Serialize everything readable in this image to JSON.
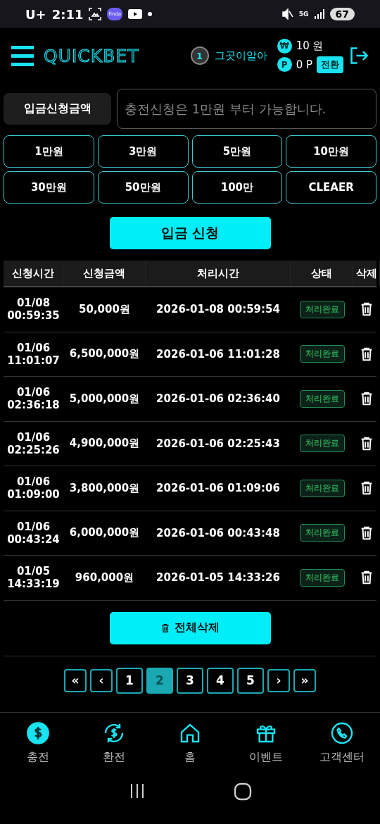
{
  "status_bar": {
    "carrier": "U+",
    "time": "2:11",
    "app_badge": "finda",
    "network": "5G",
    "battery": "67"
  },
  "header": {
    "logo": "QUICKBET",
    "level": "1",
    "username": "그곳이알아",
    "money_symbol": "₩",
    "money": "10 원",
    "point_symbol": "P",
    "points": "0 P",
    "convert_button": "전환"
  },
  "amount": {
    "label": "입금신청금액",
    "placeholder": "충전신청은 1만원 부터 가능합니다."
  },
  "quick_amounts": [
    "1만원",
    "3만원",
    "5만원",
    "10만원",
    "30만원",
    "50만원",
    "100만",
    "CLEAER"
  ],
  "submit_button": "입금 신청",
  "table": {
    "columns": [
      "신청시간",
      "신청금액",
      "처리시간",
      "상태",
      "삭제"
    ],
    "rows": [
      {
        "date": "01/08",
        "time": "00:59:35",
        "amount": "50,000원",
        "processed": "2026-01-08 00:59:54",
        "status": "처리완료"
      },
      {
        "date": "01/06",
        "time": "11:01:07",
        "amount": "6,500,000원",
        "processed": "2026-01-06 11:01:28",
        "status": "처리완료"
      },
      {
        "date": "01/06",
        "time": "02:36:18",
        "amount": "5,000,000원",
        "processed": "2026-01-06 02:36:40",
        "status": "처리완료"
      },
      {
        "date": "01/06",
        "time": "02:25:26",
        "amount": "4,900,000원",
        "processed": "2026-01-06 02:25:43",
        "status": "처리완료"
      },
      {
        "date": "01/06",
        "time": "01:09:00",
        "amount": "3,800,000원",
        "processed": "2026-01-06 01:09:06",
        "status": "처리완료"
      },
      {
        "date": "01/06",
        "time": "00:43:24",
        "amount": "6,000,000원",
        "processed": "2026-01-06 00:43:48",
        "status": "처리완료"
      },
      {
        "date": "01/05",
        "time": "14:33:19",
        "amount": "960,000원",
        "processed": "2026-01-05 14:33:26",
        "status": "처리완료"
      }
    ]
  },
  "delete_all_button": "전체삭제",
  "pagination": [
    {
      "label": "«",
      "selected": false
    },
    {
      "label": "‹",
      "selected": false
    },
    {
      "label": "1",
      "selected": false
    },
    {
      "label": "2",
      "selected": true
    },
    {
      "label": "3",
      "selected": false
    },
    {
      "label": "4",
      "selected": false
    },
    {
      "label": "5",
      "selected": false
    },
    {
      "label": "›",
      "selected": false
    },
    {
      "label": "»",
      "selected": false
    }
  ],
  "bottom_nav": [
    {
      "kind": "charge",
      "label": "충전"
    },
    {
      "kind": "exchange",
      "label": "환전"
    },
    {
      "kind": "home",
      "label": "홈"
    },
    {
      "kind": "event",
      "label": "이벤트"
    },
    {
      "kind": "support",
      "label": "고객센터"
    }
  ]
}
